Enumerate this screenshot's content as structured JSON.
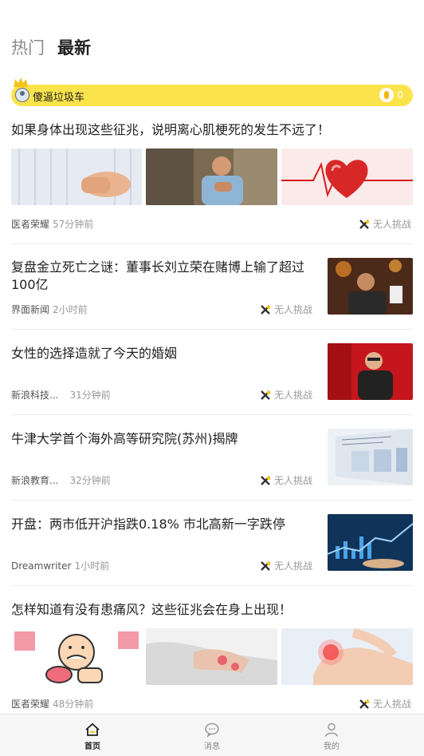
{
  "tabs": [
    {
      "label": "热门",
      "active": false
    },
    {
      "label": "最新",
      "active": true
    }
  ],
  "user_bar": {
    "name": "傻逼垃圾车",
    "coins": "0"
  },
  "articles": [
    {
      "title": "如果身体出现这些征兆，说明离心肌梗死的发生不远了！",
      "source": "医者荣耀",
      "time": "57分钟前",
      "challenge": "无人挑战",
      "thumbs": [
        "abdomen-photo",
        "man-chest-pain-photo",
        "heart-illustration"
      ]
    },
    {
      "title": "复盘金立死亡之谜：董事长刘立荣在赌博上输了超过100亿",
      "source": "界面新闻",
      "time": "2小时前",
      "challenge": "无人挑战",
      "thumbs": [
        "chairman-photo"
      ]
    },
    {
      "title": "女性的选择造就了今天的婚姻",
      "source": "新浪科技...",
      "time": "31分钟前",
      "challenge": "无人挑战",
      "thumbs": [
        "speaker-photo"
      ]
    },
    {
      "title": "牛津大学首个海外高等研究院(苏州)揭牌",
      "source": "新浪教育...",
      "time": "32分钟前",
      "challenge": "无人挑战",
      "thumbs": [
        "institute-photo"
      ]
    },
    {
      "title": "开盘：两市低开沪指跌0.18% 市北高新一字跌停",
      "source": "Dreamwriter",
      "time": "1小时前",
      "challenge": "无人挑战",
      "thumbs": [
        "stock-chart-photo"
      ]
    },
    {
      "title": "怎样知道有没有患痛风？这些征兆会在身上出现！",
      "source": "医者荣耀",
      "time": "48分钟前",
      "challenge": "无人挑战",
      "thumbs": [
        "gout-cartoon",
        "hand-pain-photo",
        "foot-pain-photo"
      ]
    }
  ],
  "bottom_nav": [
    {
      "label": "首页",
      "icon": "home-icon",
      "active": true
    },
    {
      "label": "消息",
      "icon": "message-icon",
      "active": false
    },
    {
      "label": "我的",
      "icon": "profile-icon",
      "active": false
    }
  ],
  "colors": {
    "accent": "#fbe34b",
    "text": "#222222",
    "muted": "#999999"
  }
}
